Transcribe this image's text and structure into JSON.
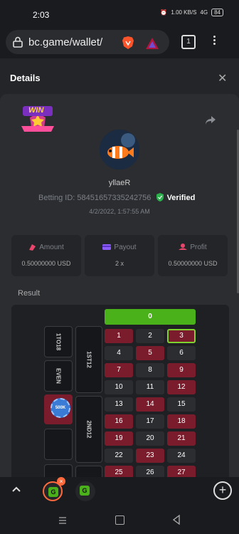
{
  "status_bar": {
    "time": "2:03",
    "net_speed": "1.00 KB/S",
    "signal": "4G",
    "battery": "84"
  },
  "browser": {
    "url": "bc.game/wallet/",
    "tab_count": "1"
  },
  "details": {
    "title": "Details",
    "badge_text": "WIN",
    "username": "yllaeR",
    "betting_label": "Betting ID:",
    "betting_id": "58451657335242756",
    "verified": "Verified",
    "date": "4/2/2022, 1:57:55 AM"
  },
  "stats": [
    {
      "label": "Amount",
      "value": "0.50000000 USD"
    },
    {
      "label": "Payout",
      "value": "2 x"
    },
    {
      "label": "Profit",
      "value": "0.50000000 USD"
    }
  ],
  "result_label": "Result",
  "board": {
    "zero": "0",
    "side_labels": [
      "1TO18",
      "EVEN",
      "1ST12",
      "2ND12"
    ],
    "chip_label": "500K",
    "selected_number": "3",
    "numbers": [
      {
        "n": "1",
        "color": "red"
      },
      {
        "n": "2",
        "color": "black"
      },
      {
        "n": "3",
        "color": "red"
      },
      {
        "n": "4",
        "color": "black"
      },
      {
        "n": "5",
        "color": "red"
      },
      {
        "n": "6",
        "color": "black"
      },
      {
        "n": "7",
        "color": "red"
      },
      {
        "n": "8",
        "color": "black"
      },
      {
        "n": "9",
        "color": "red"
      },
      {
        "n": "10",
        "color": "black"
      },
      {
        "n": "11",
        "color": "black"
      },
      {
        "n": "12",
        "color": "red"
      },
      {
        "n": "13",
        "color": "black"
      },
      {
        "n": "14",
        "color": "red"
      },
      {
        "n": "15",
        "color": "black"
      },
      {
        "n": "16",
        "color": "red"
      },
      {
        "n": "17",
        "color": "black"
      },
      {
        "n": "18",
        "color": "red"
      },
      {
        "n": "19",
        "color": "red"
      },
      {
        "n": "20",
        "color": "black"
      },
      {
        "n": "21",
        "color": "red"
      },
      {
        "n": "22",
        "color": "black"
      },
      {
        "n": "23",
        "color": "red"
      },
      {
        "n": "24",
        "color": "black"
      },
      {
        "n": "25",
        "color": "red"
      },
      {
        "n": "26",
        "color": "black"
      },
      {
        "n": "27",
        "color": "red"
      }
    ]
  },
  "colors": {
    "green": "#4ab11a",
    "red": "#7b1c2c",
    "accent": "#ff6a3d"
  }
}
